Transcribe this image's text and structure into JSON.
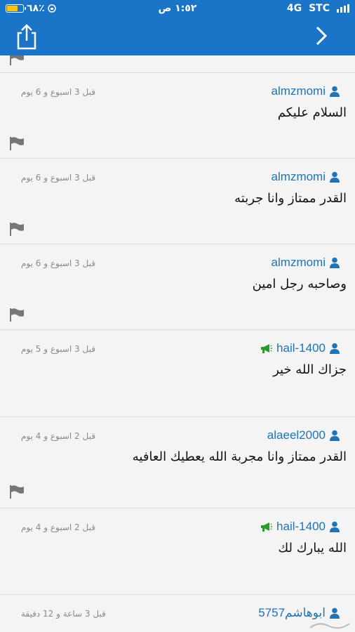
{
  "status_bar": {
    "battery": "٦٨٪",
    "time": "١:٥٢ ص",
    "network": "4G",
    "carrier": "STC",
    "battery_level": 0.68
  },
  "header": {
    "share_icon": "share-icon",
    "back_icon": "chevron-right-icon",
    "background": "#1a75c9"
  },
  "comments": [
    {
      "username": "almzmomi",
      "time": "قبل 3 اسبوع و 6 يوم",
      "text": "السلام عليكم",
      "megaphone": false
    },
    {
      "username": "almzmomi",
      "time": "قبل 3 اسبوع و 6 يوم",
      "text": "القدر ممتاز وانا جربته",
      "megaphone": false
    },
    {
      "username": "almzmomi",
      "time": "قبل 3 اسبوع و 6 يوم",
      "text": "وصاحبه رجل امين",
      "megaphone": false
    },
    {
      "username": "hail-1400",
      "time": "قبل 3 اسبوع و 5 يوم",
      "text": "جزاك الله خير",
      "megaphone": true
    },
    {
      "username": "alaeel2000",
      "time": "قبل 2 اسبوع و 4 يوم",
      "text": "القدر ممتاز وانا مجربة الله يعطيك العافيه",
      "megaphone": false
    },
    {
      "username": "hail-1400",
      "time": "قبل 2 اسبوع و 4 يوم",
      "text": "الله يبارك لك",
      "megaphone": true
    },
    {
      "username": "ابوهاشم5757",
      "time": "قبل 3 ساعة و 12 دقيقة",
      "text": "",
      "megaphone": false
    }
  ],
  "colors": {
    "username": "#1f73b7",
    "megaphone": "#2e9a2e",
    "time": "#8a8a8a",
    "flag": "#777777"
  }
}
